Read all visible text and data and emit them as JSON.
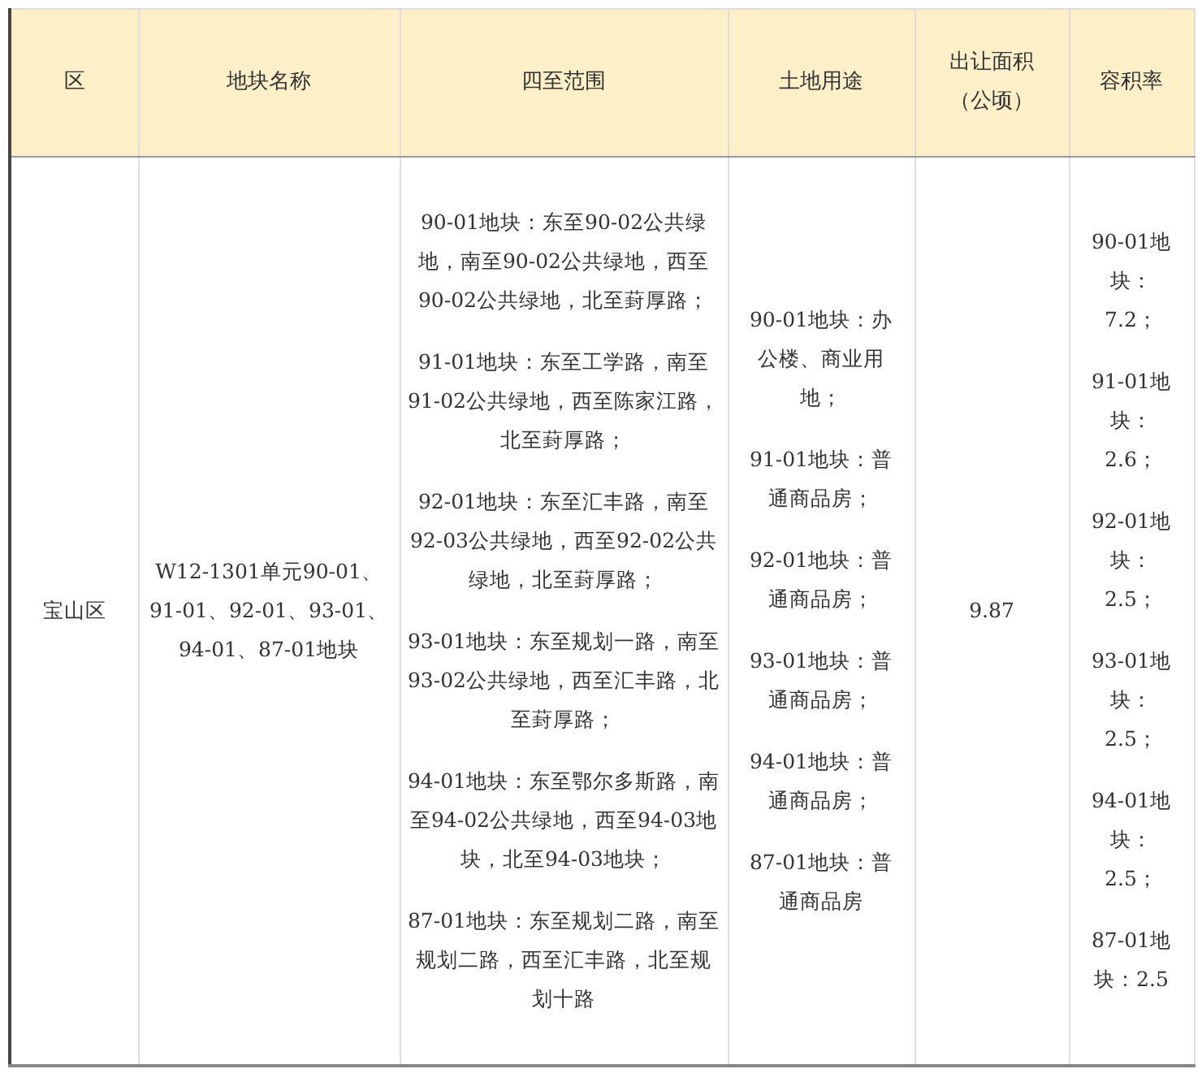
{
  "table": {
    "columns": [
      "区",
      "地块名称",
      "四至范围",
      "土地用途",
      "出让面积（公顷）",
      "容积率"
    ],
    "rows": [
      {
        "district": "宝山区",
        "parcel_name": "W12-1301单元90-01、91-01、92-01、93-01、94-01、87-01地块",
        "boundaries": [
          "90-01地块：东至90-02公共绿地，南至90-02公共绿地，西至90-02公共绿地，北至葑厚路；",
          "91-01地块：东至工学路，南至91-02公共绿地，西至陈家江路，北至葑厚路；",
          "92-01地块：东至汇丰路，南至92-03公共绿地，西至92-02公共绿地，北至葑厚路；",
          "93-01地块：东至规划一路，南至93-02公共绿地，西至汇丰路，北至葑厚路；",
          "94-01地块：东至鄂尔多斯路，南至94-02公共绿地，西至94-03地块，北至94-03地块；",
          "87-01地块：东至规划二路，南至规划二路，西至汇丰路，北至规划十路"
        ],
        "land_use": [
          "90-01地块：办公楼、商业用地；",
          "91-01地块：普通商品房；",
          "92-01地块：普通商品房；",
          "93-01地块：普通商品房；",
          "94-01地块：普通商品房；",
          "87-01地块：普通商品房"
        ],
        "area": "9.87",
        "plot_ratio": [
          "90-01地块：7.2；",
          "91-01地块：2.6；",
          "92-01地块：2.5；",
          "93-01地块：2.5；",
          "94-01地块：2.5；",
          "87-01地块：2.5"
        ]
      }
    ]
  }
}
